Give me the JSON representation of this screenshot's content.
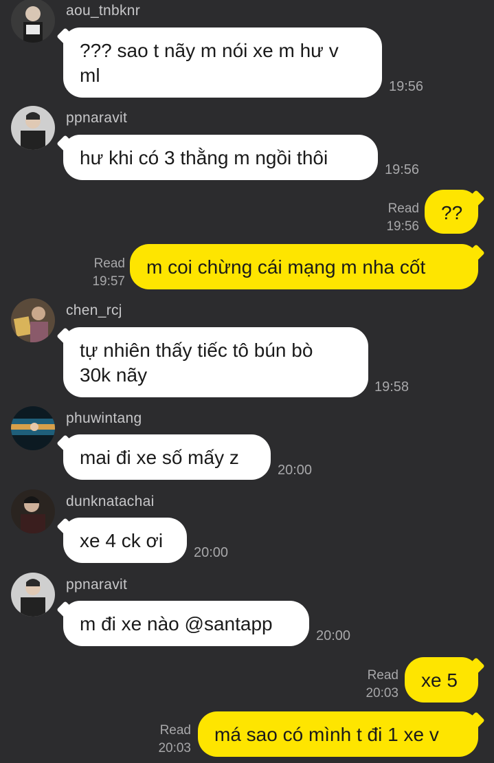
{
  "colors": {
    "background": "#2c2c2e",
    "incoming_bubble": "#ffffff",
    "outgoing_bubble": "#fee500",
    "username": "#c7c7c9",
    "meta": "#a8a8aa"
  },
  "messages": [
    {
      "sender": "aou_tnbknr",
      "text": "??? sao t nãy m nói xe m hư v\nml",
      "time": "19:56"
    },
    {
      "sender": "ppnaravit",
      "text": "hư khi có 3 thằng m ngồi thôi",
      "time": "19:56"
    },
    {
      "outgoing": true,
      "status": "Read",
      "text": "??",
      "time": "19:56"
    },
    {
      "outgoing": true,
      "status": "Read",
      "text": "m coi chừng cái mạng m nha cốt",
      "time": "19:57"
    },
    {
      "sender": "chen_rcj",
      "text": "tự nhiên thấy tiếc tô bún bò\n30k nãy",
      "time": "19:58"
    },
    {
      "sender": "phuwintang",
      "text": "mai đi xe số mấy z",
      "time": "20:00"
    },
    {
      "sender": "dunknatachai",
      "text": "xe 4 ck ơi",
      "time": "20:00"
    },
    {
      "sender": "ppnaravit",
      "text": "m đi xe nào @santapp",
      "time": "20:00"
    },
    {
      "outgoing": true,
      "status": "Read",
      "text": "xe 5",
      "time": "20:03"
    },
    {
      "outgoing": true,
      "status": "Read",
      "text": "má sao có mình t đi 1 xe v",
      "time": "20:03"
    }
  ]
}
